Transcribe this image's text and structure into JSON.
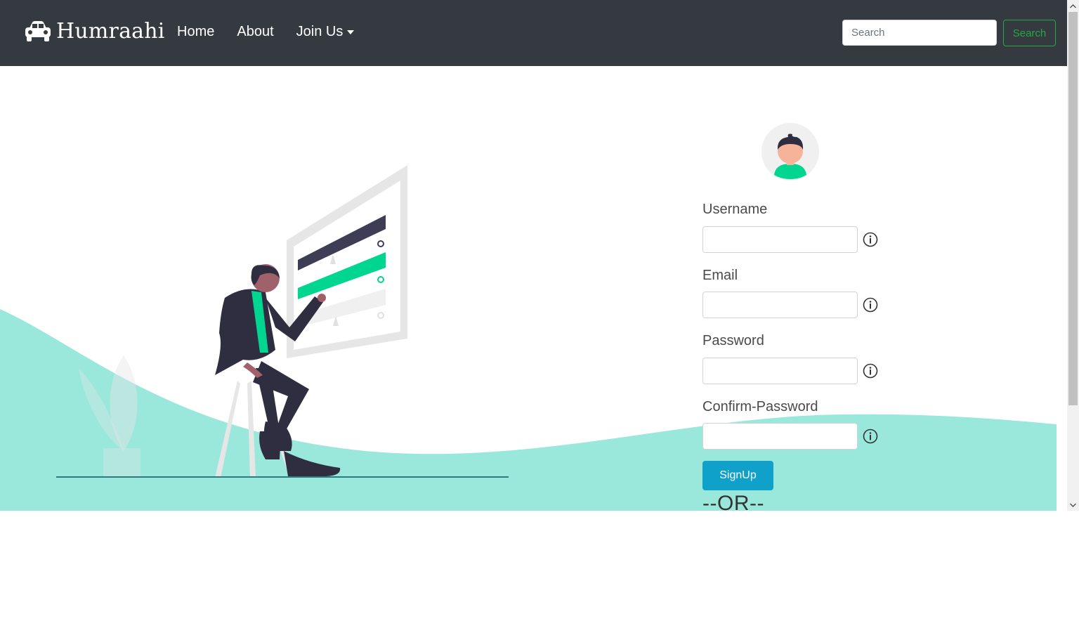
{
  "navbar": {
    "brand": "Humraahi",
    "links": [
      {
        "label": "Home"
      },
      {
        "label": "About"
      },
      {
        "label": "Join Us"
      }
    ],
    "search_placeholder": "Search",
    "search_button": "Search"
  },
  "form": {
    "fields": [
      {
        "label": "Username",
        "value": ""
      },
      {
        "label": "Email",
        "value": ""
      },
      {
        "label": "Password",
        "value": ""
      },
      {
        "label": "Confirm-Password",
        "value": ""
      }
    ],
    "signup_button": "SignUp",
    "or_text": "--OR--"
  },
  "icons": {
    "brand": "car-icon",
    "dropdown": "caret-down-icon",
    "field_help": "info-icon",
    "avatar": "user-avatar-icon"
  },
  "colors": {
    "navbar_bg": "#343a40",
    "search_accent": "#28a745",
    "signup_bg": "#0fa1c9",
    "wave": "#9ae8dc",
    "highlight": "#00d68f"
  }
}
